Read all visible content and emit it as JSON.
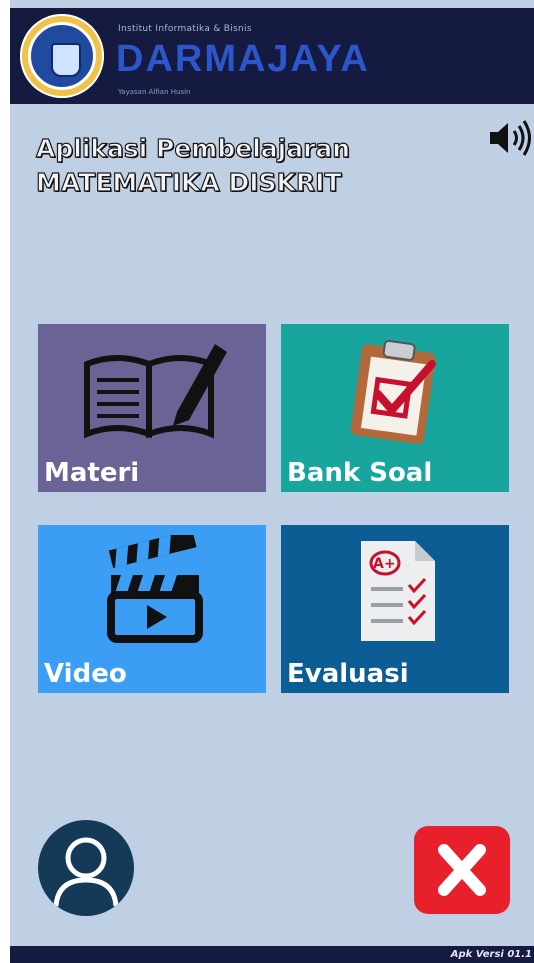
{
  "header": {
    "institute_line": "Institut Informatika & Bisnis",
    "brand": "DARMAJAYA",
    "foundation_line": "Yayasan Alfian Husin"
  },
  "app_title_line1": "Aplikasi Pembelajaran",
  "app_title_line2": "MATEMATIKA DISKRIT",
  "menu": [
    {
      "label": "Materi",
      "icon": "book-pencil-icon",
      "color": "#6a6395"
    },
    {
      "label": "Bank Soal",
      "icon": "clipboard-check-icon",
      "color": "#17a59e"
    },
    {
      "label": "Video",
      "icon": "clapperboard-play-icon",
      "color": "#3b9ef4"
    },
    {
      "label": "Evaluasi",
      "icon": "graded-checklist-icon",
      "color": "#0c5d93"
    }
  ],
  "controls": {
    "sound_icon": "speaker-icon",
    "profile_icon": "user-avatar-icon",
    "exit_icon": "close-x-icon"
  },
  "footer": {
    "version": "Apk Versi 01.1"
  }
}
